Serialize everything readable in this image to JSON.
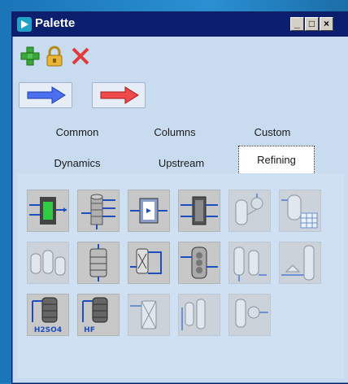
{
  "window": {
    "title": "Palette",
    "min_label": "_",
    "max_label": "□",
    "close_label": "×"
  },
  "toolbar": {
    "add_icon": "plus-icon",
    "lock_icon": "lock-icon",
    "delete_icon": "close-x-icon",
    "back_arrow_icon": "arrow-right-blue-icon",
    "forward_arrow_icon": "arrow-right-red-icon"
  },
  "tabs": [
    {
      "label": "Common",
      "active": false
    },
    {
      "label": "Columns",
      "active": false
    },
    {
      "label": "Custom",
      "active": false
    },
    {
      "label": "Dynamics",
      "active": false
    },
    {
      "label": "Upstream",
      "active": false
    },
    {
      "label": "Refining",
      "active": true
    }
  ],
  "palette_items": {
    "row1": [
      "heater-icon",
      "distillation-column-icon",
      "separator-icon",
      "heat-exchanger-icon",
      "tank-valve-icon",
      "tank-table-icon"
    ],
    "row2": [
      "flash-drums-icon",
      "reactor-column-icon",
      "loop-reactor-icon",
      "packed-column-icon",
      "two-vessels-icon",
      "column-pump-icon"
    ],
    "row3": [
      "h2so4-tank-icon",
      "hf-tank-icon",
      "cross-reactor-icon",
      "vessel-bank-icon",
      "compressor-vessel-icon"
    ]
  },
  "labels": {
    "h2so4": "H2SO4",
    "hf": "HF"
  },
  "colors": {
    "title_bar": "#0c1f6e",
    "window_bg": "#c9dcef",
    "icon_bg": "#c8c8c8",
    "accent_blue": "#1d4fbf"
  }
}
